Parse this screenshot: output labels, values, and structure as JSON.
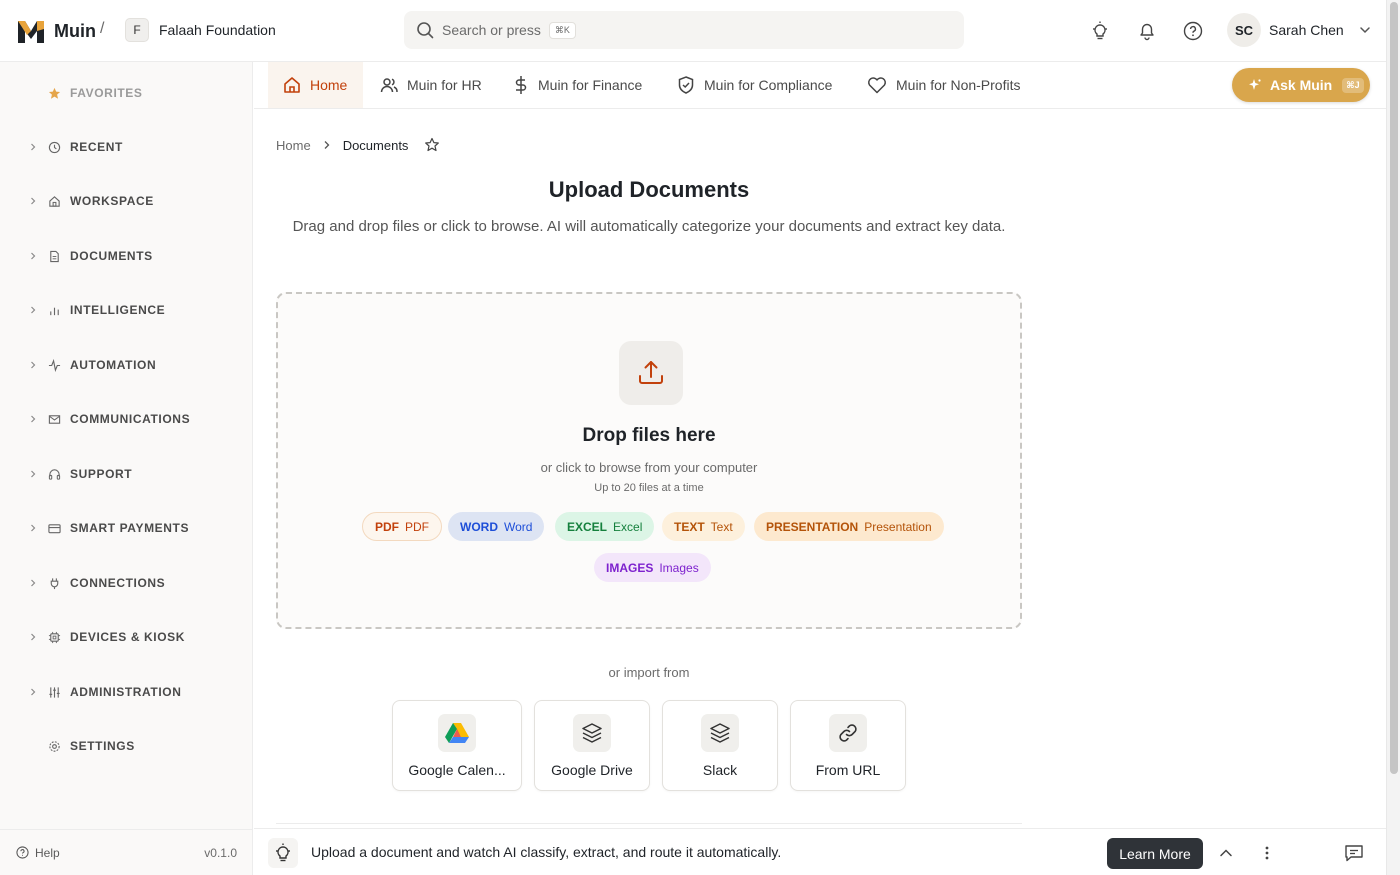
{
  "app": {
    "logo_text": "Muin",
    "org_initial": "F",
    "org_name": "Falaah Foundation"
  },
  "search": {
    "placeholder": "Search or press",
    "shortcut": "⌘K"
  },
  "user": {
    "initials": "SC",
    "name": "Sarah Chen"
  },
  "sidebar": {
    "items": [
      {
        "label": "FAVORITES",
        "icon": "star-icon"
      },
      {
        "label": "RECENT",
        "icon": "clock-icon"
      },
      {
        "label": "WORKSPACE",
        "icon": "home-icon"
      },
      {
        "label": "DOCUMENTS",
        "icon": "document-icon"
      },
      {
        "label": "INTELLIGENCE",
        "icon": "bar-chart-icon"
      },
      {
        "label": "AUTOMATION",
        "icon": "activity-icon"
      },
      {
        "label": "COMMUNICATIONS",
        "icon": "mail-icon"
      },
      {
        "label": "SUPPORT",
        "icon": "headset-icon"
      },
      {
        "label": "SMART PAYMENTS",
        "icon": "credit-card-icon"
      },
      {
        "label": "CONNECTIONS",
        "icon": "plug-icon"
      },
      {
        "label": "DEVICES & KIOSK",
        "icon": "chip-icon"
      },
      {
        "label": "ADMINISTRATION",
        "icon": "sliders-icon"
      },
      {
        "label": "SETTINGS",
        "icon": "gear-icon"
      }
    ],
    "help_label": "Help",
    "version": "v0.1.0"
  },
  "tabs": [
    {
      "label": "Home",
      "icon": "home-icon"
    },
    {
      "label": "Muin for HR",
      "icon": "users-icon"
    },
    {
      "label": "Muin for Finance",
      "icon": "dollar-icon"
    },
    {
      "label": "Muin for Compliance",
      "icon": "shield-icon"
    },
    {
      "label": "Muin for Non-Profits",
      "icon": "heart-icon"
    }
  ],
  "ask": {
    "label": "Ask Muin",
    "shortcut": "⌘J"
  },
  "breadcrumb": {
    "home": "Home",
    "current": "Documents"
  },
  "page": {
    "title": "Upload Documents",
    "subtitle": "Drag and drop files or click to browse. AI will automatically categorize your documents and extract key data."
  },
  "dropzone": {
    "title": "Drop files here",
    "subtitle": "or click to browse from your computer",
    "limit": "Up to 20 files at a time",
    "file_types": [
      {
        "code": "PDF",
        "name": "PDF",
        "color": "#c2410c",
        "bg": "#fdf6ee"
      },
      {
        "code": "WORD",
        "name": "Word",
        "color": "#1d4ed8",
        "bg": "#dde4f3"
      },
      {
        "code": "EXCEL",
        "name": "Excel",
        "color": "#15803d",
        "bg": "#dcf5e6"
      },
      {
        "code": "TEXT",
        "name": "Text",
        "color": "#b45309",
        "bg": "#fdf0dc"
      },
      {
        "code": "PRESENTATION",
        "name": "Presentation",
        "color": "#b45309",
        "bg": "#fde9cf"
      },
      {
        "code": "IMAGES",
        "name": "Images",
        "color": "#7e22ce",
        "bg": "#f3e6fa"
      }
    ]
  },
  "import": {
    "label": "or import from",
    "sources": [
      {
        "label": "Google Calen...",
        "icon": "google-drive-logo-icon"
      },
      {
        "label": "Google Drive",
        "icon": "layers-icon"
      },
      {
        "label": "Slack",
        "icon": "layers-icon"
      },
      {
        "label": "From URL",
        "icon": "link-icon"
      }
    ]
  },
  "tip": {
    "text": "Upload a document and watch AI classify, extract, and route it automatically.",
    "learn_more": "Learn More"
  }
}
